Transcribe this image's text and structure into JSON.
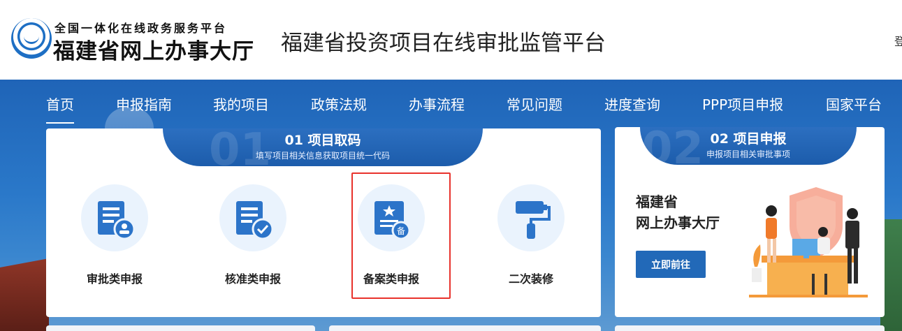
{
  "header": {
    "logo_line1": "全国一体化在线政务服务平台",
    "logo_line2": "福建省网上办事大厅",
    "platform_title": "福建省投资项目在线审批监管平台",
    "login_edge": "登"
  },
  "nav": {
    "items": [
      {
        "label": "首页",
        "active": true
      },
      {
        "label": "申报指南"
      },
      {
        "label": "我的项目"
      },
      {
        "label": "政策法规"
      },
      {
        "label": "办事流程"
      },
      {
        "label": "常见问题"
      },
      {
        "label": "进度查询"
      },
      {
        "label": "PPP项目申报"
      },
      {
        "label": "国家平台"
      }
    ]
  },
  "section1": {
    "bg_number": "01",
    "title": "01 项目取码",
    "subtitle": "填写项目相关信息获取项目统一代码",
    "services": [
      {
        "label": "审批类申报",
        "icon": "approval-doc-icon"
      },
      {
        "label": "核准类申报",
        "icon": "verify-doc-icon"
      },
      {
        "label": "备案类申报",
        "icon": "record-doc-icon",
        "highlighted": true,
        "badge": "备"
      },
      {
        "label": "二次装修",
        "icon": "paint-roller-icon"
      }
    ]
  },
  "section2": {
    "bg_number": "02",
    "title": "02 项目申报",
    "subtitle": "申报项目相关审批事项",
    "heading_line1": "福建省",
    "heading_line2": "网上办事大厅",
    "button_label": "立即前往"
  },
  "colors": {
    "primary": "#2269b8",
    "highlight_border": "#e8322c",
    "icon_blue": "#2c74c9",
    "icon_circle": "#eaf3fd"
  }
}
